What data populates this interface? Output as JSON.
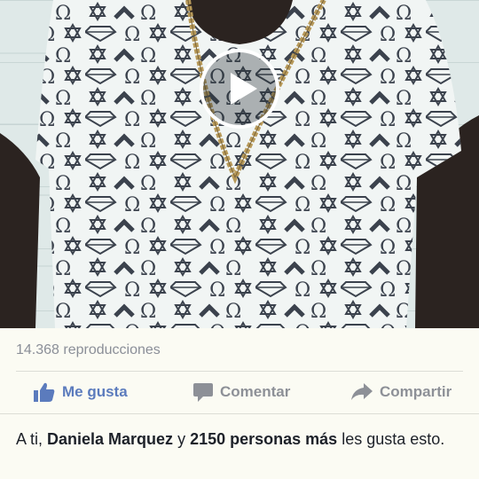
{
  "post": {
    "views": "14.368 reproducciones",
    "actions": {
      "like": "Me gusta",
      "comment": "Comentar",
      "share": "Compartir"
    },
    "likes": {
      "prefix": "A ti, ",
      "name": "Daniela Marquez",
      "connector": " y ",
      "others": "2150 personas más",
      "suffix": " les gusta esto."
    }
  },
  "icons": {
    "play": "play-icon",
    "like": "thumbs-up-icon",
    "comment": "speech-bubble-icon",
    "share": "share-arrow-icon"
  },
  "colors": {
    "like_blue": "#5b7bbd",
    "muted_gray": "#8d9097",
    "background": "#fbfbf3"
  }
}
